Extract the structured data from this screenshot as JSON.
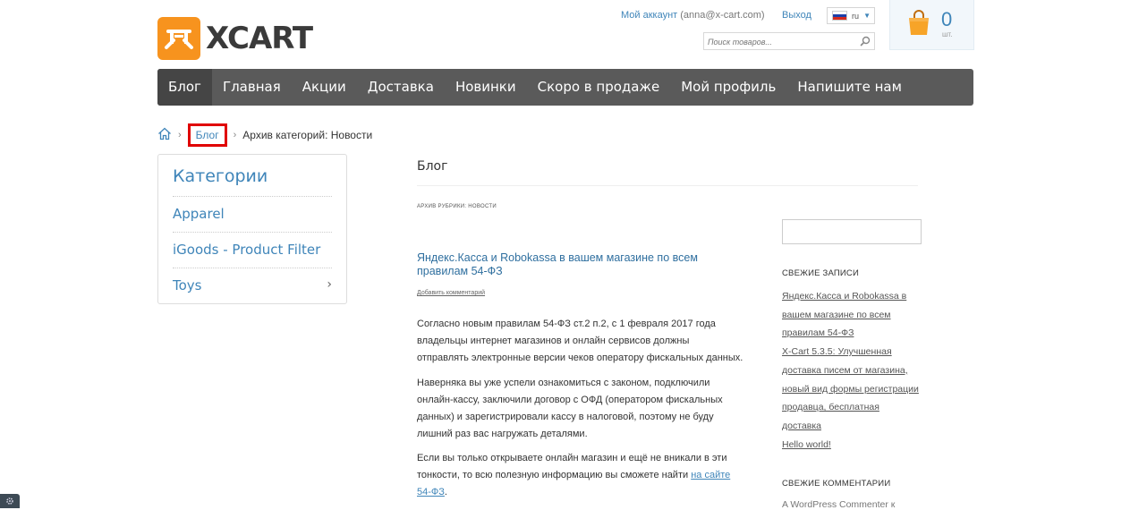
{
  "header": {
    "logo_text": "XCART",
    "account_label": "Мой аккаунт",
    "account_email": "(anna@x-cart.com)",
    "logout_label": "Выход",
    "language": {
      "code": "ru",
      "flag_colors": [
        "#ffffff",
        "#1c3fa8",
        "#d52b1e"
      ]
    },
    "search_placeholder": "Поиск товаров...",
    "cart": {
      "count": "0",
      "unit": "шт."
    }
  },
  "nav": {
    "items": [
      {
        "label": "Блог",
        "active": true
      },
      {
        "label": "Главная"
      },
      {
        "label": "Акции"
      },
      {
        "label": "Доставка"
      },
      {
        "label": "Новинки"
      },
      {
        "label": "Скоро в продаже"
      },
      {
        "label": "Мой профиль"
      },
      {
        "label": "Напишите нам"
      }
    ]
  },
  "breadcrumb": {
    "separator": "›",
    "blog": "Блог",
    "current": "Архив категорий: Новости"
  },
  "sidebar": {
    "title": "Категории",
    "categories": [
      {
        "label": "Apparel"
      },
      {
        "label": "iGoods - Product Filter"
      },
      {
        "label": "Toys",
        "chevron": "›"
      }
    ]
  },
  "main": {
    "page_title": "Блог",
    "archive_label": "АРХИВ РУБРИКИ: НОВОСТИ",
    "post_title": "Яндекс.Касса и Robokassa в вашем магазине по всем правилам 54-ФЗ",
    "comment_link": "Добавить комментарий",
    "paragraphs": [
      "Согласно новым правилам 54-ФЗ ст.2 п.2, с 1 февраля 2017 года владельцы интернет магазинов и онлайн сервисов должны отправлять электронные версии чеков оператору фискальных данных.",
      "Наверняка вы уже успели ознакомиться с законом, подключили онлайн-кассу, заключили договор с ОФД (оператором фискальных данных) и зарегистрировали кассу в налоговой, поэтому не буду лишний раз вас нагружать деталями."
    ],
    "para3_text": "Если вы только открываете онлайн магазин и ещё не вникали в эти тонкости, то всю полезную информацию вы сможете найти ",
    "para3_link": "на сайте 54-ФЗ",
    "para3_end": "."
  },
  "widgets": {
    "recent_posts_title": "СВЕЖИЕ ЗАПИСИ",
    "recent_posts": [
      "Яндекс.Касса и Robokassa в вашем магазине по всем правилам 54-ФЗ",
      "X-Cart 5.3.5: Улучшенная доставка писем от магазина, новый вид формы регистрации продавца, бесплатная доставка",
      "Hello world!"
    ],
    "recent_comments_title": "СВЕЖИЕ КОММЕНТАРИИ",
    "recent_comment": "A WordPress Commenter к"
  }
}
